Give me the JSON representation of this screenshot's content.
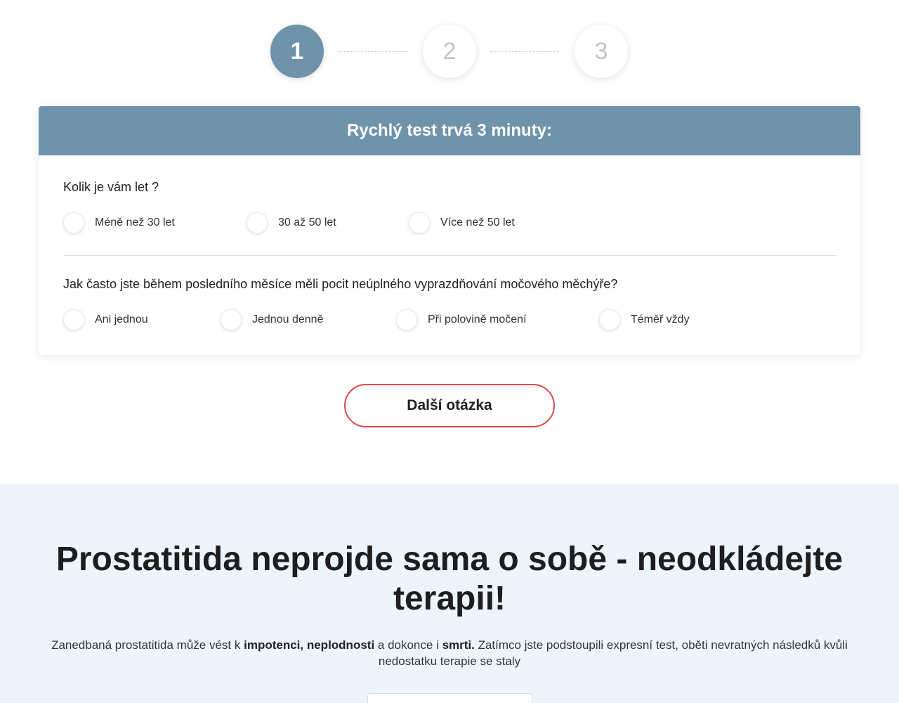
{
  "stepper": {
    "steps": [
      {
        "label": "1",
        "state": "active"
      },
      {
        "label": "2",
        "state": "inactive"
      },
      {
        "label": "3",
        "state": "inactive"
      }
    ]
  },
  "quiz": {
    "title": "Rychlý test trvá 3 minuty:",
    "questions": [
      {
        "text": "Kolik je vám let ?",
        "options": [
          "Méně než 30 let",
          "30 až 50 let",
          "Více než 50 let"
        ]
      },
      {
        "text": "Jak často jste během posledního měsíce měli pocit neúplného vyprazdňování močového měchýře?",
        "options": [
          "Ani jednou",
          "Jednou denně",
          "Při polovině močení",
          "Téměř vždy"
        ]
      }
    ],
    "next_label": "Další otázka"
  },
  "info": {
    "title": "Prostatitida neprojde sama o sobě - neodkládejte terapii!",
    "text_parts": [
      "Zanedbaná prostatitida může vést k ",
      "impotenci, neplodnosti",
      " a dokonce i ",
      "smrti.",
      " Zatímco jste podstoupili expresní test, oběti nevratných následků kvůli nedostatku terapie se staly"
    ]
  },
  "colors": {
    "accent": "#6e93aa",
    "button_border": "#e04a4a",
    "info_bg": "#edf5fb"
  }
}
